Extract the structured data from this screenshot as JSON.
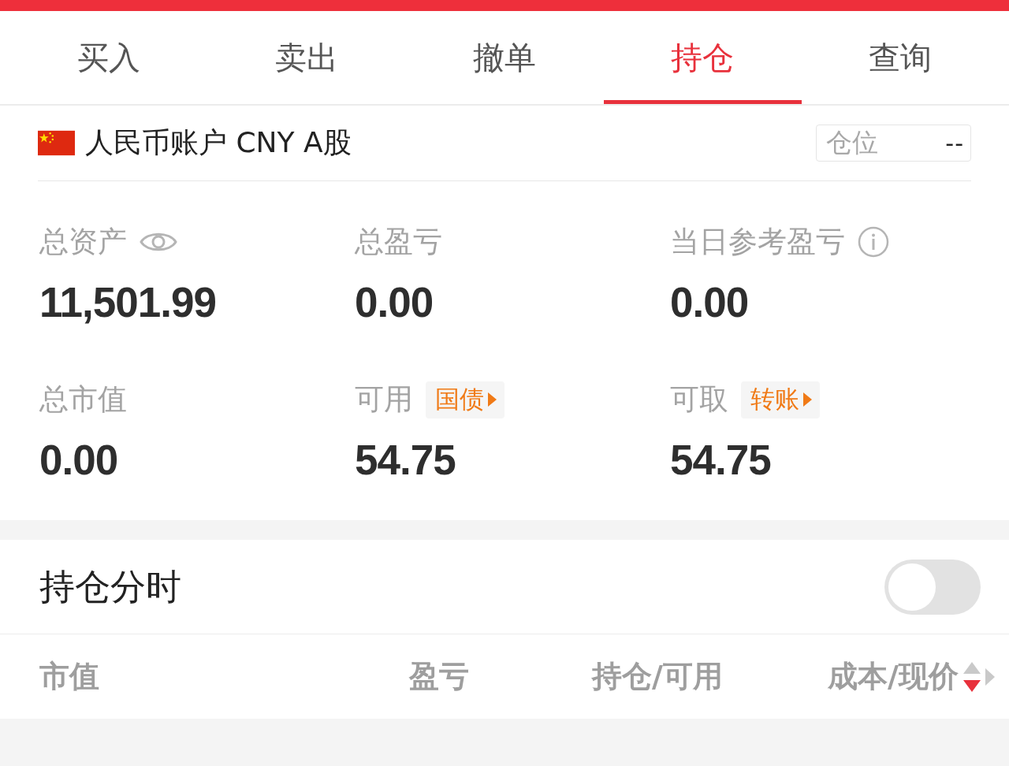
{
  "tabs": [
    {
      "label": "买入",
      "selected": false
    },
    {
      "label": "卖出",
      "selected": false
    },
    {
      "label": "撤单",
      "selected": false
    },
    {
      "label": "持仓",
      "selected": true
    },
    {
      "label": "查询",
      "selected": false
    }
  ],
  "account": {
    "label": "人民币账户 CNY A股",
    "position": {
      "label": "仓位",
      "value": "--"
    }
  },
  "summary": [
    {
      "kind": "hideable",
      "label": "总资产",
      "value": "11,501.99"
    },
    {
      "kind": "plain",
      "label": "总盈亏",
      "value": "0.00"
    },
    {
      "kind": "info",
      "label": "当日参考盈亏",
      "value": "0.00"
    },
    {
      "kind": "plain",
      "label": "总市值",
      "value": "0.00"
    },
    {
      "kind": "link",
      "label": "可用",
      "link_label": "国债",
      "value": "54.75"
    },
    {
      "kind": "link",
      "label": "可取",
      "link_label": "转账",
      "value": "54.75"
    }
  ],
  "intraday": {
    "label": "持仓分时",
    "on": false
  },
  "holdings": {
    "scrollable": true,
    "columns": [
      {
        "label": "市值"
      },
      {
        "label": "盈亏"
      },
      {
        "label": "持仓/可用"
      },
      {
        "label": "成本/现价",
        "sort_descending": true
      }
    ]
  }
}
